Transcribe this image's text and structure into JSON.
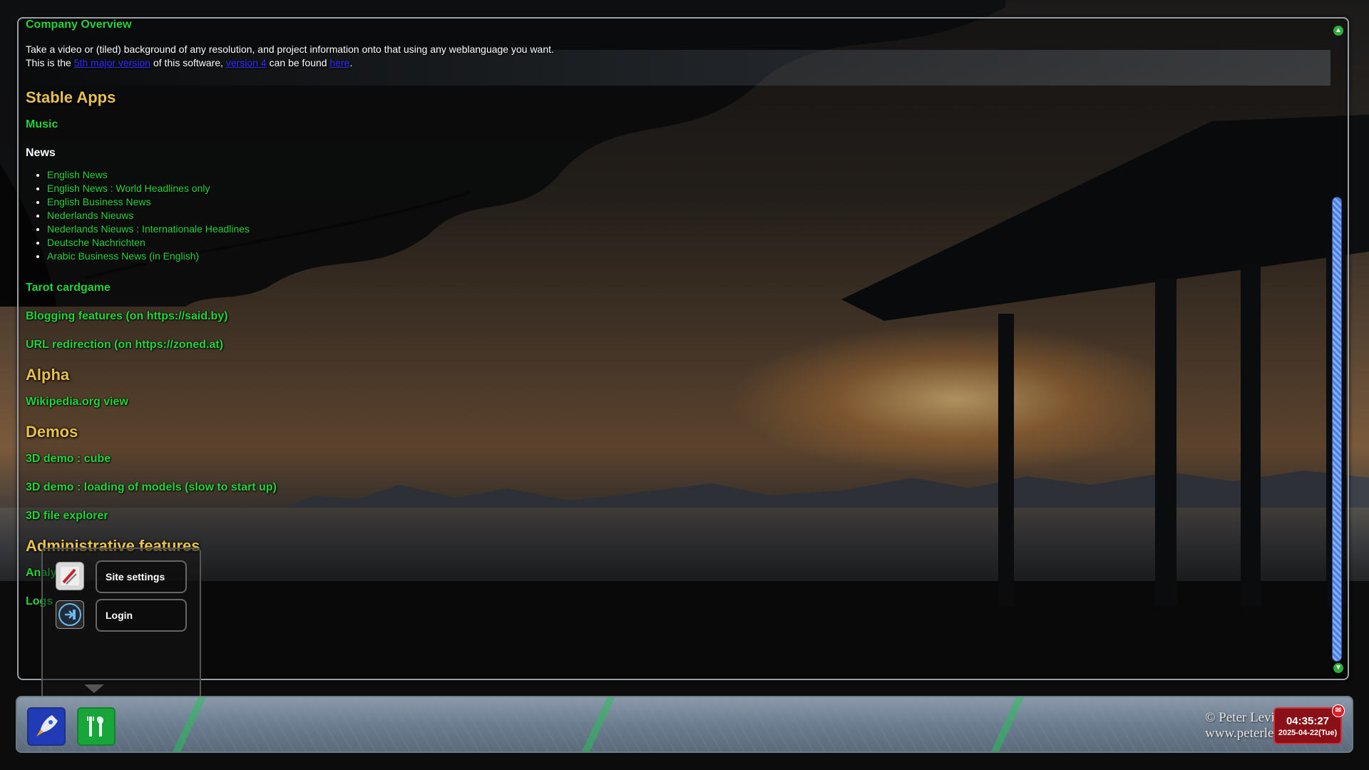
{
  "intro": {
    "company_overview": "Company Overview",
    "line1": "Take a video or (tiled) background of any resolution, and project information onto that using any weblanguage you want.",
    "line2_a": "This is the ",
    "line2_link1": "5th major version",
    "line2_b": " of this software, ",
    "line2_link2": "version 4",
    "line2_c": " can be found ",
    "line2_link3": "here",
    "line2_d": "."
  },
  "sections": {
    "stable_apps": "Stable Apps",
    "music": "Music",
    "news": "News",
    "news_items": [
      "English News",
      "English News : World Headlines only",
      "English Business News",
      "Nederlands Nieuws",
      "Nederlands Nieuws : Internationale Headlines",
      "Deutsche Nachrichten",
      "Arabic Business News (in English)"
    ],
    "tarot": "Tarot cardgame",
    "blogging": "Blogging features (on https://said.by)",
    "url_redirection": "URL redirection (on https://zoned.at)",
    "alpha": "Alpha",
    "wikipedia": "Wikipedia.org view",
    "demos": "Demos",
    "demo_cube": "3D demo : cube",
    "demo_models": "3D demo : loading of models (slow to start up)",
    "file_explorer": "3D file explorer",
    "admin": "Administrative features",
    "analytics": "Analy",
    "logs": "Logs"
  },
  "popup": {
    "site_settings": "Site settings",
    "login": "Login"
  },
  "taskbar": {
    "copyright_line1": "© Peter Levi",
    "copyright_line2": "www.peterlev",
    "clock_time": "04:35:27",
    "clock_date": "2025-04-22(Tue)"
  },
  "colors": {
    "link_green": "#22d53a",
    "heading_gold": "#e8c24a",
    "clock_red": "#8a0f17"
  }
}
